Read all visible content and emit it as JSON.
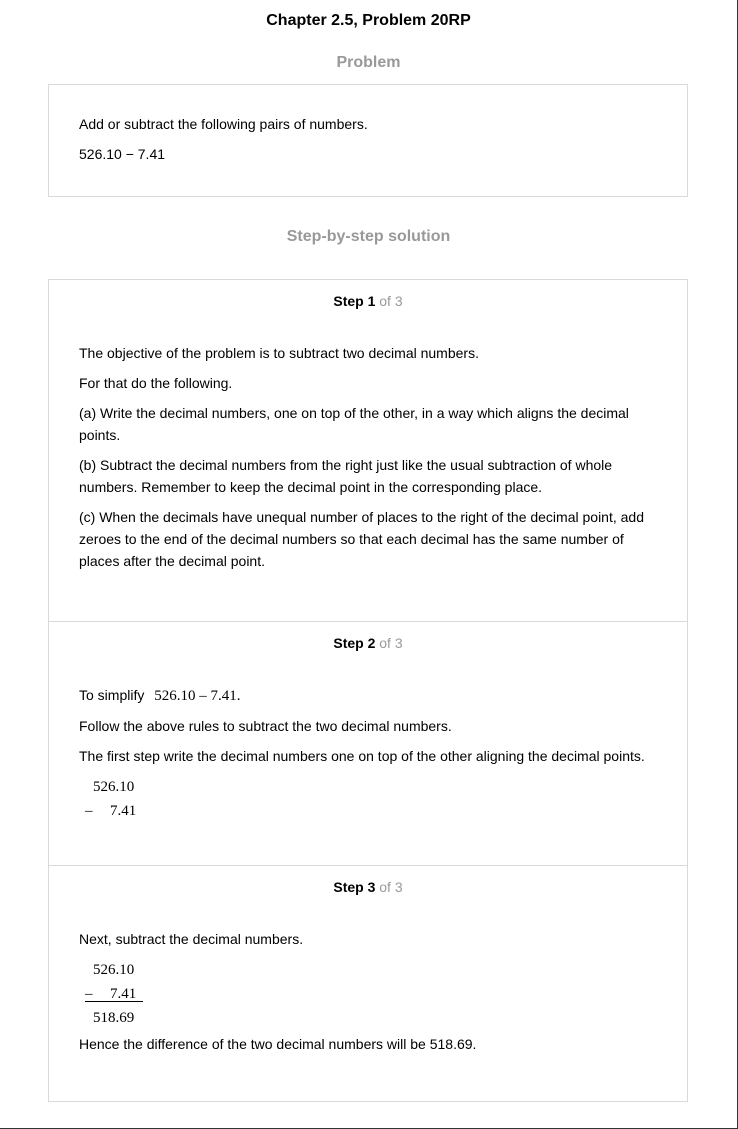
{
  "page": {
    "title": "Chapter 2.5, Problem 20RP"
  },
  "problem": {
    "heading": "Problem",
    "instruction": "Add or subtract the following pairs of numbers.",
    "expression": "526.10 − 7.41"
  },
  "solution": {
    "heading": "Step-by-step solution",
    "steps": [
      {
        "label": "Step 1",
        "of": "of 3",
        "paragraphs": [
          "The objective of the problem is to subtract two decimal numbers.",
          "For that do the following.",
          "(a) Write the decimal numbers, one on top of the other, in a way which aligns the decimal points.",
          "(b) Subtract the decimal numbers from the right just like the usual subtraction of whole numbers. Remember to keep the decimal point in the corresponding place.",
          "(c) When the decimals have unequal number of places to the right of the decimal point, add zeroes to the end of the decimal numbers so that each decimal has the same number of places after the decimal point."
        ]
      },
      {
        "label": "Step 2",
        "of": "of 3",
        "intro_text": "To simplify",
        "intro_math": "526.10 – 7.41.",
        "paragraphs": [
          "Follow the above rules to subtract the two decimal numbers.",
          "The first step write the decimal numbers one on top of the other aligning the decimal points."
        ],
        "calc": {
          "top": "526.10",
          "op": "–",
          "bottom": "7.41"
        }
      },
      {
        "label": "Step 3",
        "of": "of 3",
        "intro": "Next, subtract the decimal numbers.",
        "calc": {
          "top": "526.10",
          "op": "–",
          "bottom": "7.41",
          "result": "518.69"
        },
        "conclusion": "Hence the difference of the two decimal numbers will be 518.69."
      }
    ]
  }
}
